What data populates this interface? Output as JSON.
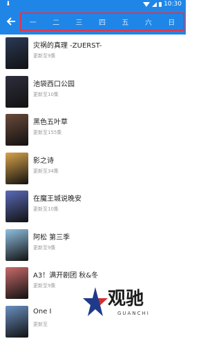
{
  "status_bar": {
    "time": "10:30"
  },
  "app_bar": {
    "back_icon": "arrow-left-icon",
    "days": [
      "一",
      "二",
      "三",
      "四",
      "五",
      "六",
      "日"
    ]
  },
  "list": [
    {
      "title": "灾祸的真理 -ZUERST-",
      "update": "更新至9集",
      "color": "#2b3a56"
    },
    {
      "title": "池袋西口公园",
      "update": "更新至10集",
      "color": "#2f2f3e"
    },
    {
      "title": "黑色五叶草",
      "update": "更新至155集",
      "color": "#6a4a3a"
    },
    {
      "title": "影之诗",
      "update": "更新至34集",
      "color": "#d8a34a"
    },
    {
      "title": "在魔王城说晚安",
      "update": "更新至10集",
      "color": "#5a6ab8"
    },
    {
      "title": "阿松 第三季",
      "update": "更新至9集",
      "color": "#8fbfe0"
    },
    {
      "title": "A3！满开剧团 秋&冬",
      "update": "更新至9集",
      "color": "#c86a6a"
    },
    {
      "title": "One I",
      "update": "更新至",
      "color": "#6a8fbf"
    }
  ],
  "watermark": {
    "brand": "观驰",
    "sub": "GUANCHI"
  }
}
